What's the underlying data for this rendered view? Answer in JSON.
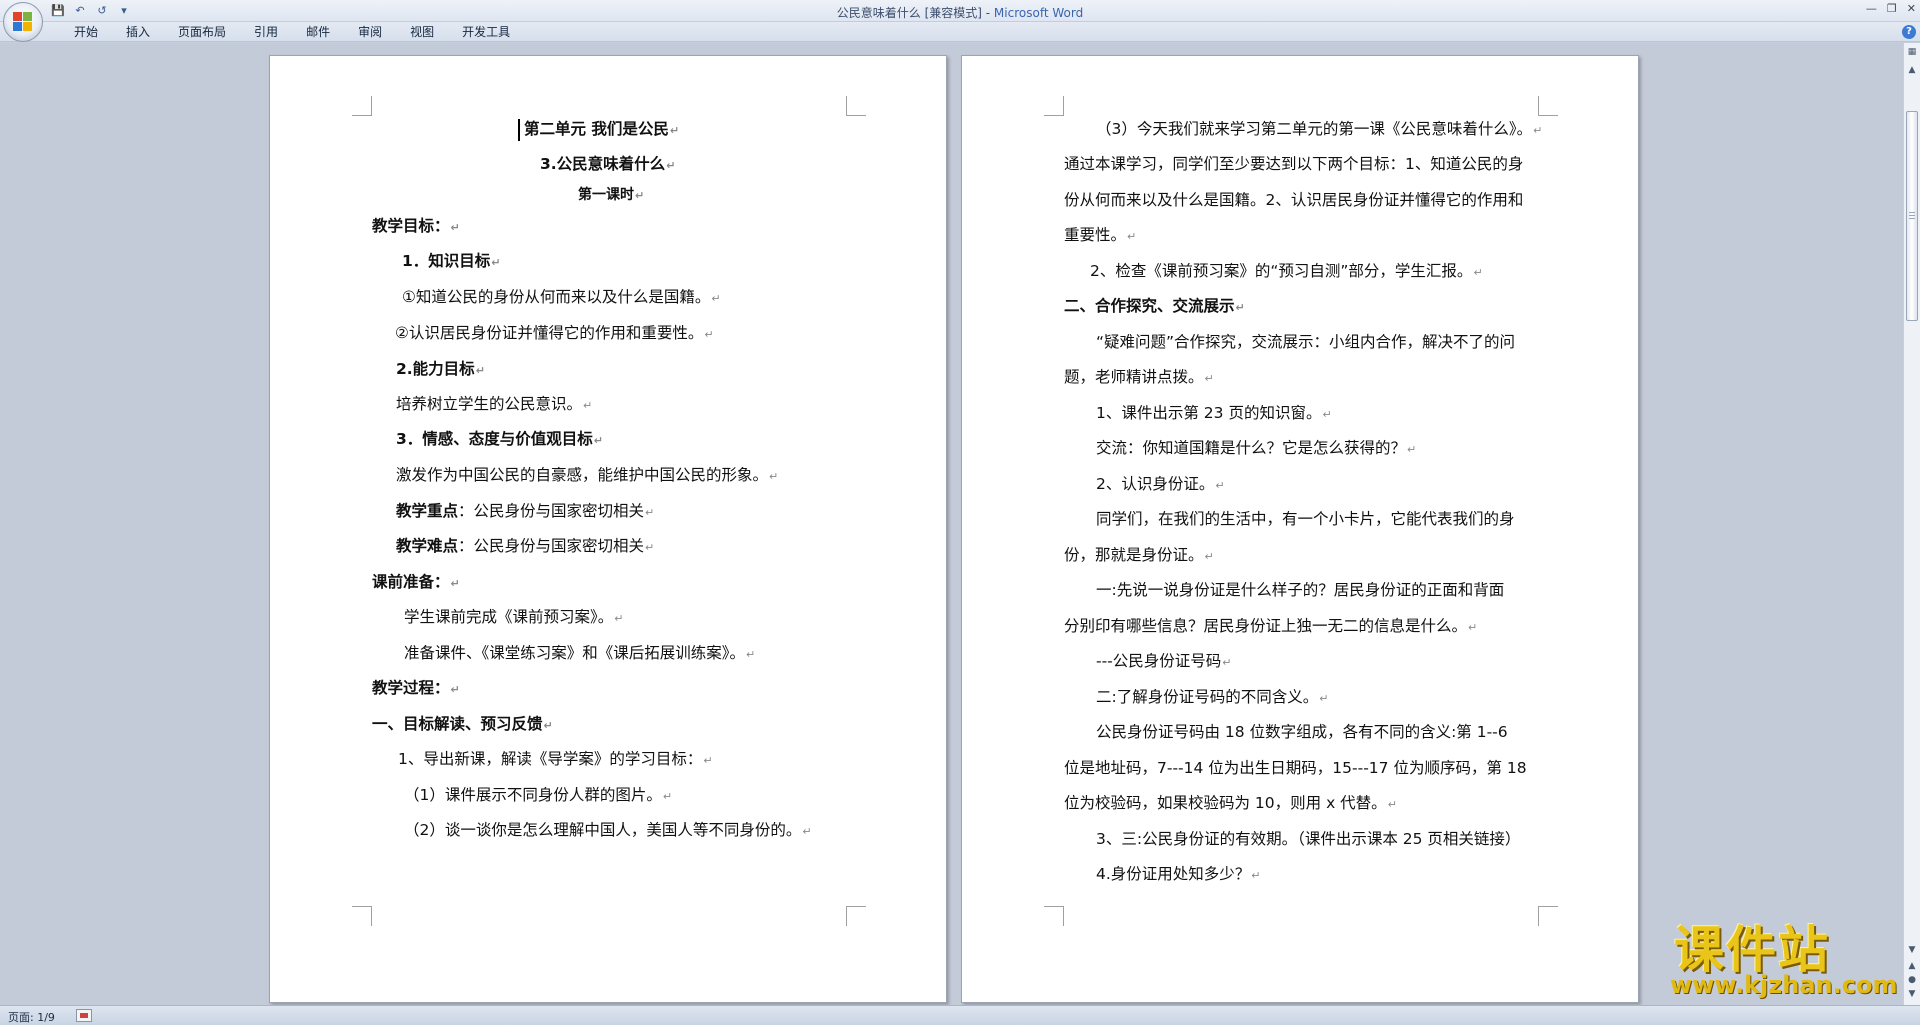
{
  "window": {
    "title_doc": "公民意味着什么 [兼容模式] - ",
    "title_app": "Microsoft Word"
  },
  "ribbon": {
    "tabs": [
      "开始",
      "插入",
      "页面布局",
      "引用",
      "邮件",
      "审阅",
      "视图",
      "开发工具"
    ]
  },
  "status": {
    "page": "页面: 1/9"
  },
  "watermark": {
    "brand": "课件站",
    "url": "www.kjzhan.com"
  },
  "page1": {
    "unit_title": "第二单元    我们是公民",
    "lesson_title": "3.公民意味着什么",
    "period": "第一课时",
    "goals_heading": "教学目标：",
    "knowledge_heading": "1．知识目标",
    "knowledge_1": "①知道公民的身份从何而来以及什么是国籍。",
    "knowledge_2": "②认识居民身份证并懂得它的作用和重要性。",
    "ability_heading": "2.能力目标",
    "ability_text": "培养树立学生的公民意识。",
    "emotion_heading": "3．情感、态度与价值观目标",
    "emotion_text": "激发作为中国公民的自豪感，能维护中国公民的形象。",
    "key_label": "教学重点",
    "key_text": "：公民身份与国家密切相关",
    "difficulty_label": "教学难点",
    "difficulty_text": "：公民身份与国家密切相关",
    "prep_heading": "课前准备：",
    "prep_1": "学生课前完成《课前预习案》。",
    "prep_2": "准备课件、《课堂练习案》和《课后拓展训练案》。",
    "process_heading": "教学过程：",
    "section_1": "一、目标解读、预习反馈",
    "step_1": "1、导出新课，解读《导学案》的学习目标：",
    "step_1a": "（1）课件展示不同身份人群的图片。",
    "step_1b": "（2）谈一谈你是怎么理解中国人，美国人等不同身份的。"
  },
  "page2": {
    "p1_l1": "（3）今天我们就来学习第二单元的第一课《公民意味着什么》。",
    "p1_l2": "通过本课学习，同学们至少要达到以下两个目标：1、知道公民的身",
    "p1_l3": "份从何而来以及什么是国籍。2、认识居民身份证并懂得它的作用和",
    "p1_l4": "重要性。",
    "check": "2、检查《课前预习案》的“预习自测”部分，学生汇报。",
    "section_2": "二、合作探究、交流展示",
    "coop_l1": "“疑难问题”合作探究，交流展示：小组内合作，解决不了的问",
    "coop_l2": "题，老师精讲点拨。",
    "item_1": "1、课件出示第 23 页的知识窗。",
    "exchange": "交流：你知道国籍是什么？它是怎么获得的？",
    "item_2": "2、认识身份证。",
    "intro_l1": "同学们，在我们的生活中，有一个小卡片，它能代表我们的身",
    "intro_l2": "份，那就是身份证。",
    "q1_l1": "一:先说一说身份证是什么样子的？居民身份证的正面和背面",
    "q1_l2": "分别印有哪些信息？居民身份证上独一无二的信息是什么。",
    "answer": "---公民身份证号码",
    "q2": "二:了解身份证号码的不同含义。",
    "code_l1": "公民身份证号码由 18 位数字组成，各有不同的含义:第 1--6",
    "code_l2": "位是地址码，7---14 位为出生日期码，15---17 位为顺序码，第 18",
    "code_l3": "位为校验码，如果校验码为 10，则用 x 代替。",
    "q3": "3、三:公民身份证的有效期。（课件出示课本 25 页相关链接）",
    "q4": "4.身份证用处知多少？"
  }
}
